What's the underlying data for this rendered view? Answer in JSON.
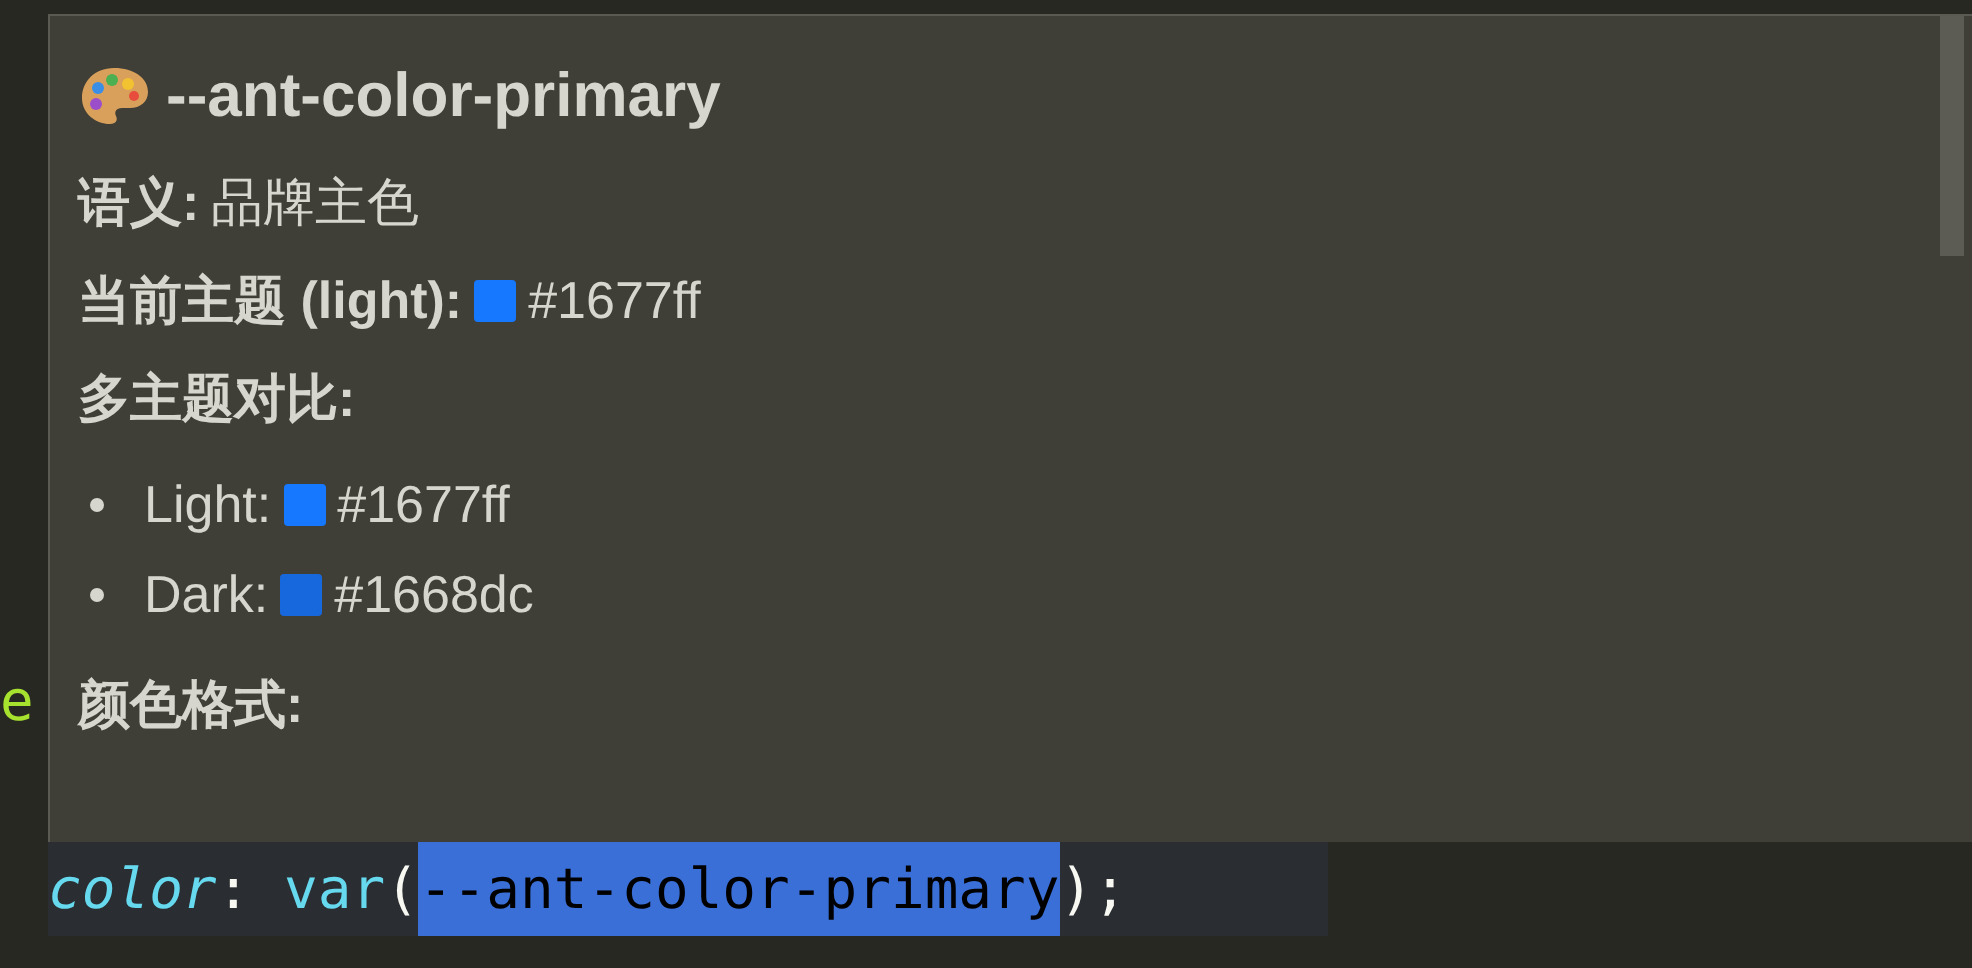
{
  "hover": {
    "title": "--ant-color-primary",
    "semantic": {
      "label": "语义:",
      "value": "品牌主色"
    },
    "current": {
      "label": "当前主题 (light):",
      "color": "#1677ff",
      "value": "#1677ff"
    },
    "compare_heading": "多主题对比:",
    "themes": [
      {
        "label": "Light:",
        "color": "#1677ff",
        "value": "#1677ff"
      },
      {
        "label": "Dark:",
        "color": "#1668dc",
        "value": "#1668dc"
      }
    ],
    "format_heading": "颜色格式:"
  },
  "gutter_fragment": "e",
  "code_line": [
    {
      "text": "color",
      "kind": "property"
    },
    {
      "text": ": ",
      "kind": "punct"
    },
    {
      "text": "var",
      "kind": "function"
    },
    {
      "text": "(",
      "kind": "punct"
    },
    {
      "text": "--ant-color-primary",
      "kind": "selected"
    },
    {
      "text": ");",
      "kind": "punct"
    }
  ]
}
